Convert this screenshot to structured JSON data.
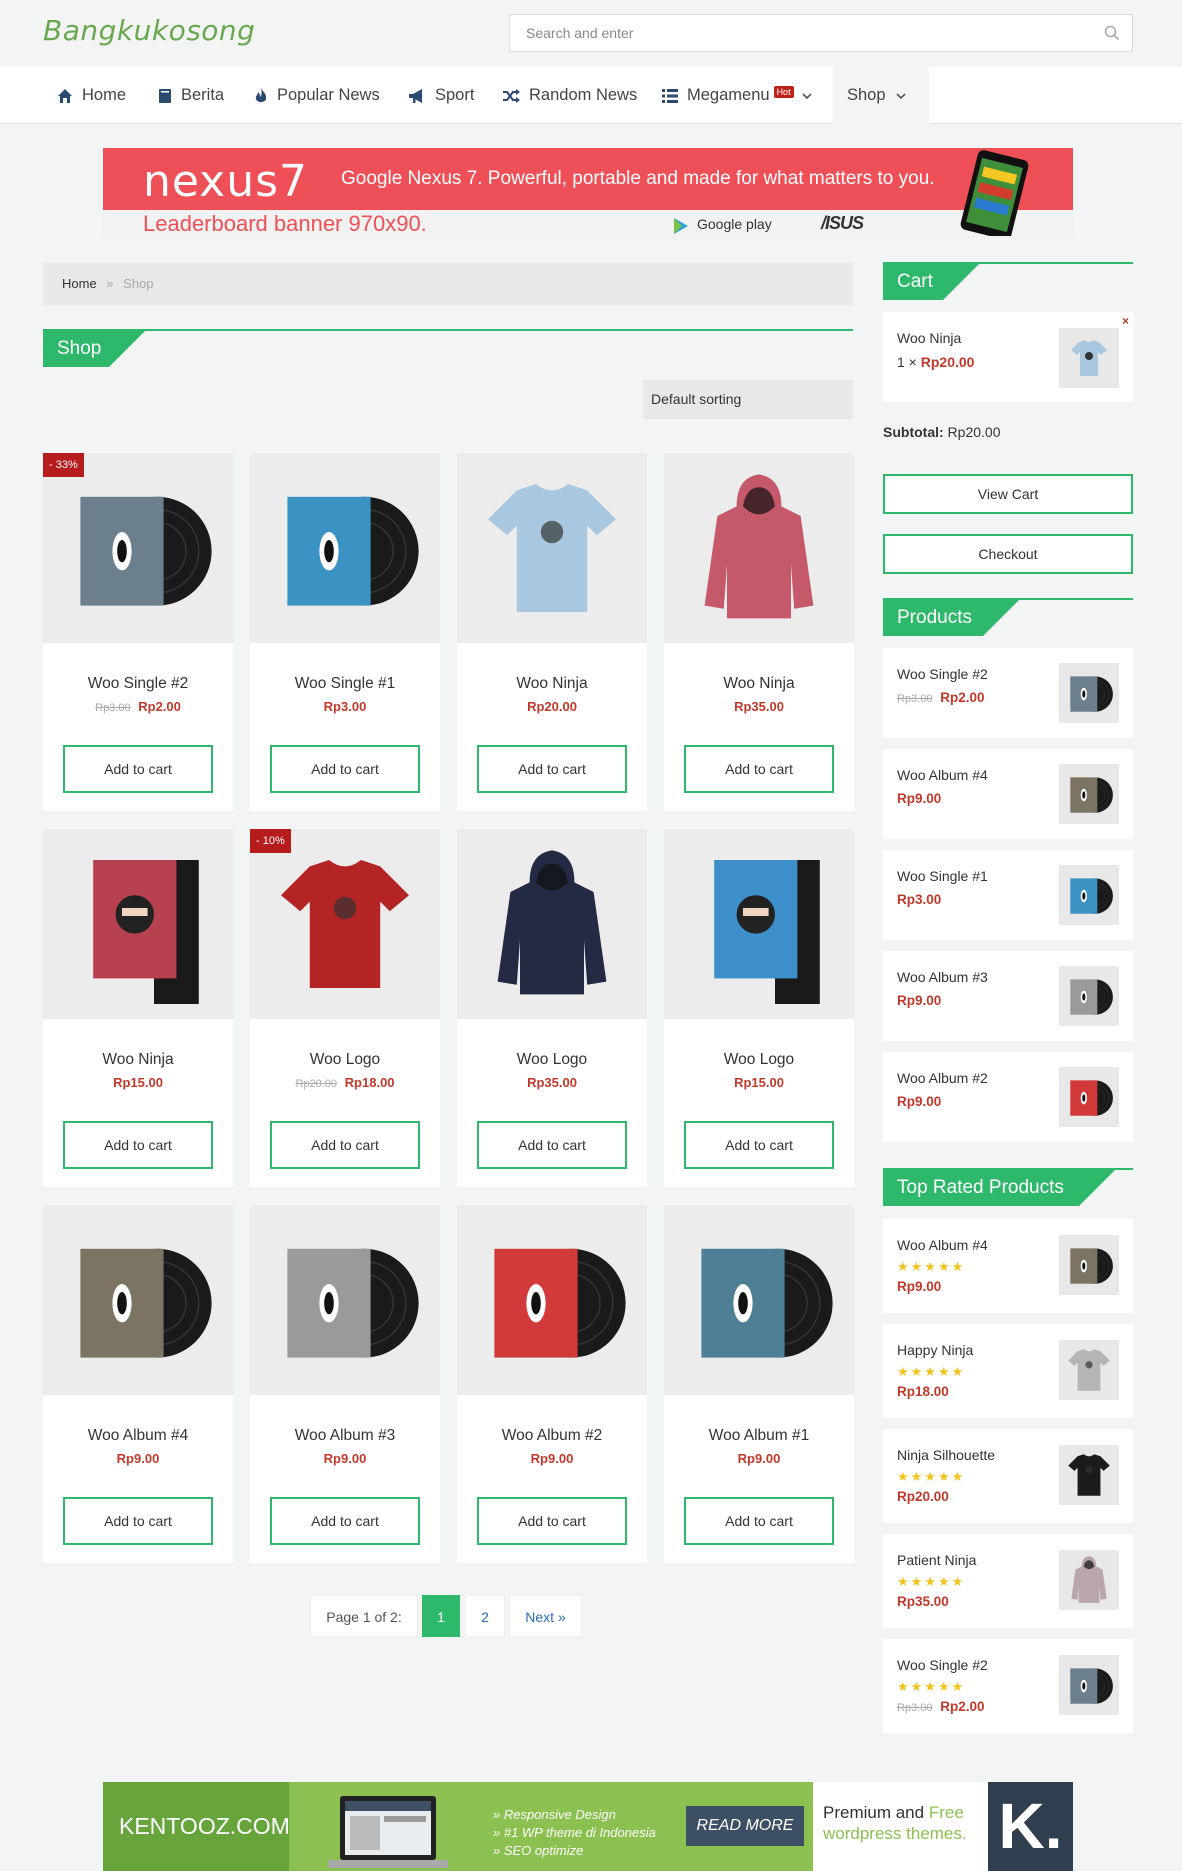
{
  "site": {
    "logo": "Bangkukosong"
  },
  "search": {
    "placeholder": "Search and enter"
  },
  "nav": {
    "items": [
      {
        "label": "Home"
      },
      {
        "label": "Berita"
      },
      {
        "label": "Popular News"
      },
      {
        "label": "Sport"
      },
      {
        "label": "Random News"
      },
      {
        "label": "Megamenu"
      },
      {
        "label": "Shop"
      }
    ],
    "hot_badge": "Hot"
  },
  "banner": {
    "brand": "nexus7",
    "tagline": "Google Nexus 7. Powerful, portable and made for what matters to you.",
    "leaderboard": "Leaderboard banner 970x90.",
    "gplay": "Google play",
    "asus": "/ISUS"
  },
  "breadcrumb": {
    "home": "Home",
    "sep": "»",
    "current": "Shop"
  },
  "shop": {
    "title": "Shop",
    "sorting": "Default sorting"
  },
  "products": [
    {
      "name": "Woo Single #2",
      "old": "Rp3.00",
      "price": "Rp2.00",
      "badge": "- 33%",
      "btn": "Add to cart",
      "kind": "vinyl",
      "color": "#6c7f8d"
    },
    {
      "name": "Woo Single #1",
      "old": "",
      "price": "Rp3.00",
      "badge": "",
      "btn": "Add to cart",
      "kind": "vinyl",
      "color": "#3b93c4"
    },
    {
      "name": "Woo Ninja",
      "old": "",
      "price": "Rp20.00",
      "badge": "",
      "btn": "Add to cart",
      "kind": "tshirt",
      "color": "#a9c8e0"
    },
    {
      "name": "Woo Ninja",
      "old": "",
      "price": "Rp35.00",
      "badge": "",
      "btn": "Add to cart",
      "kind": "hoodie",
      "color": "#c5596a"
    },
    {
      "name": "Woo Ninja",
      "old": "",
      "price": "Rp15.00",
      "badge": "",
      "btn": "Add to cart",
      "kind": "poster",
      "color": "#b8414f"
    },
    {
      "name": "Woo Logo",
      "old": "Rp20.00",
      "price": "Rp18.00",
      "badge": "- 10%",
      "btn": "Add to cart",
      "kind": "tshirt",
      "color": "#b52424"
    },
    {
      "name": "Woo Logo",
      "old": "",
      "price": "Rp35.00",
      "badge": "",
      "btn": "Add to cart",
      "kind": "hoodie",
      "color": "#242a44"
    },
    {
      "name": "Woo Logo",
      "old": "",
      "price": "Rp15.00",
      "badge": "",
      "btn": "Add to cart",
      "kind": "poster",
      "color": "#3c8fc9"
    },
    {
      "name": "Woo Album #4",
      "old": "",
      "price": "Rp9.00",
      "badge": "",
      "btn": "Add to cart",
      "kind": "vinyl",
      "color": "#7b7462"
    },
    {
      "name": "Woo Album #3",
      "old": "",
      "price": "Rp9.00",
      "badge": "",
      "btn": "Add to cart",
      "kind": "vinyl",
      "color": "#9a9a9a"
    },
    {
      "name": "Woo Album #2",
      "old": "",
      "price": "Rp9.00",
      "badge": "",
      "btn": "Add to cart",
      "kind": "vinyl",
      "color": "#d23a3a"
    },
    {
      "name": "Woo Album #1",
      "old": "",
      "price": "Rp9.00",
      "badge": "",
      "btn": "Add to cart",
      "kind": "vinyl",
      "color": "#4e7f94"
    }
  ],
  "pagination": {
    "label": "Page 1 of 2:",
    "p1": "1",
    "p2": "2",
    "next": "Next »"
  },
  "cart": {
    "title": "Cart",
    "item": {
      "name": "Woo Ninja",
      "qty": "1 ×",
      "price": "Rp20.00"
    },
    "remove": "×",
    "subtotal_label": "Subtotal:",
    "subtotal_value": "Rp20.00",
    "view": "View Cart",
    "checkout": "Checkout"
  },
  "products_widget": {
    "title": "Products",
    "items": [
      {
        "name": "Woo Single #2",
        "old": "Rp3.00",
        "price": "Rp2.00",
        "color": "#6c7f8d"
      },
      {
        "name": "Woo Album #4",
        "old": "",
        "price": "Rp9.00",
        "color": "#7b7462"
      },
      {
        "name": "Woo Single #1",
        "old": "",
        "price": "Rp3.00",
        "color": "#3b93c4"
      },
      {
        "name": "Woo Album #3",
        "old": "",
        "price": "Rp9.00",
        "color": "#9a9a9a"
      },
      {
        "name": "Woo Album #2",
        "old": "",
        "price": "Rp9.00",
        "color": "#d23a3a"
      }
    ]
  },
  "top_rated": {
    "title": "Top Rated Products",
    "items": [
      {
        "name": "Woo Album #4",
        "old": "",
        "price": "Rp9.00",
        "stars": "★★★★★",
        "kind": "vinyl",
        "color": "#7b7462"
      },
      {
        "name": "Happy Ninja",
        "old": "",
        "price": "Rp18.00",
        "stars": "★★★★★",
        "kind": "tshirt",
        "color": "#b5b5b5"
      },
      {
        "name": "Ninja Silhouette",
        "old": "",
        "price": "Rp20.00",
        "stars": "★★★★★",
        "kind": "tshirt",
        "color": "#1b1b1b"
      },
      {
        "name": "Patient Ninja",
        "old": "",
        "price": "Rp35.00",
        "stars": "★★★★★",
        "kind": "hoodie",
        "color": "#b8a5ad"
      },
      {
        "name": "Woo Single #2",
        "old": "Rp3.00",
        "price": "Rp2.00",
        "stars": "★★★★★",
        "kind": "vinyl",
        "color": "#6c7f8d"
      }
    ]
  },
  "footer_banner": {
    "brand": "KENTOOZ.COM",
    "lines": [
      "» Responsive Design",
      "» #1 WP theme di Indonesia",
      "» SEO optimize"
    ],
    "cta": "READ MORE",
    "prem1": "Premium and",
    "prem1g": "Free",
    "prem2": "wordpress themes.",
    "k": "K."
  }
}
